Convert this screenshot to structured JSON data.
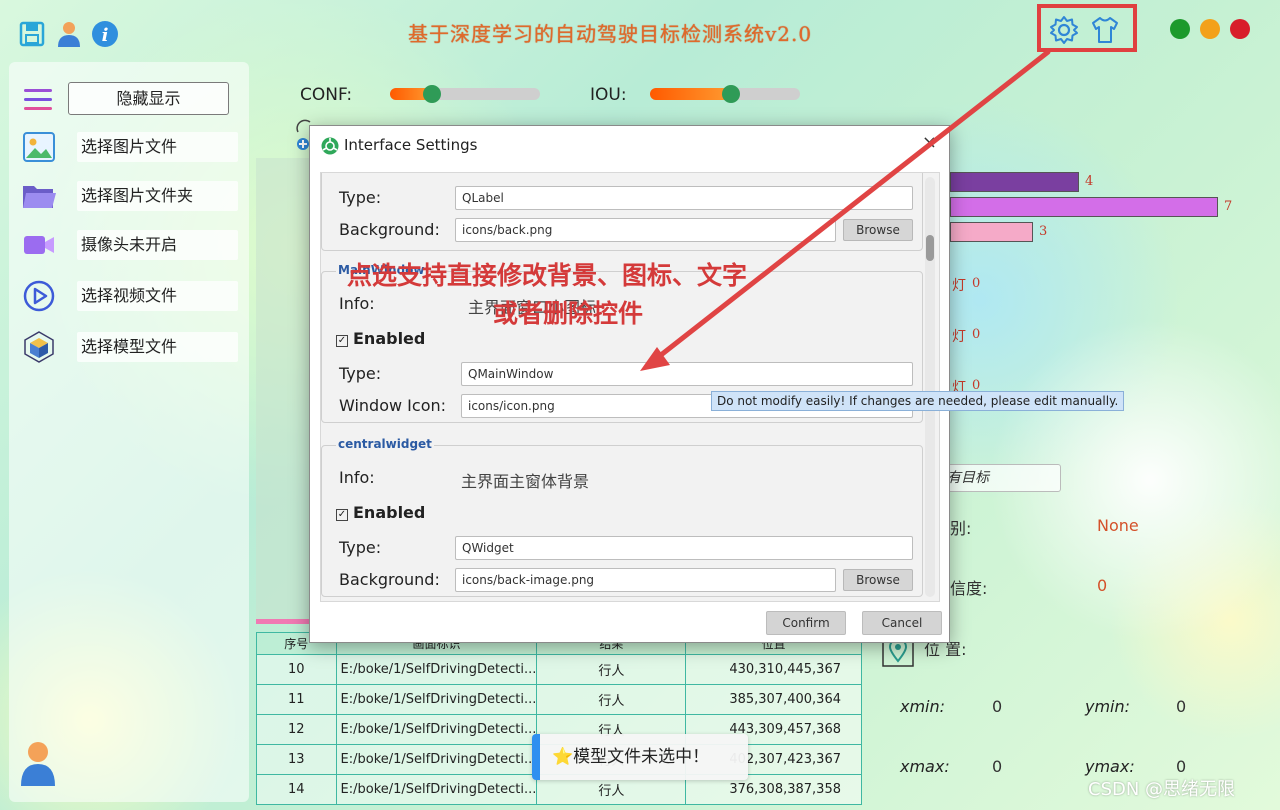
{
  "header": {
    "title": "基于深度学习的自动驾驶目标检测系统v2.0",
    "icons": [
      "save-icon",
      "user-icon",
      "info-icon",
      "settings-icon",
      "shirt-icon"
    ],
    "window_dots": [
      "#1c9a2c",
      "#f3a11a",
      "#d81e2a"
    ]
  },
  "sidebar": {
    "toggle_label": "隐藏显示",
    "items": [
      {
        "label": "选择图片文件",
        "icon": "image-icon"
      },
      {
        "label": "选择图片文件夹",
        "icon": "folder-icon"
      },
      {
        "label": "摄像头未开启",
        "icon": "camera-icon"
      },
      {
        "label": "选择视频文件",
        "icon": "play-icon"
      },
      {
        "label": "选择模型文件",
        "icon": "model-cube-icon"
      }
    ]
  },
  "sliders": {
    "conf": {
      "label": "CONF:",
      "value": 0.28
    },
    "iou": {
      "label": "IOU:",
      "value": 0.54
    }
  },
  "table": {
    "headers": [
      "序号",
      "画面标识",
      "结果",
      "位置"
    ],
    "rows": [
      {
        "id": "10",
        "path": "E:/boke/1/SelfDrivingDetecti...",
        "result": "行人",
        "pos": "430,310,445,367"
      },
      {
        "id": "11",
        "path": "E:/boke/1/SelfDrivingDetecti...",
        "result": "行人",
        "pos": "385,307,400,364"
      },
      {
        "id": "12",
        "path": "E:/boke/1/SelfDrivingDetecti...",
        "result": "行人",
        "pos": "443,309,457,368"
      },
      {
        "id": "13",
        "path": "E:/boke/1/SelfDrivingDetecti...",
        "result": "行人",
        "pos": "402,307,423,367"
      },
      {
        "id": "14",
        "path": "E:/boke/1/SelfDrivingDetecti...",
        "result": "行人",
        "pos": "376,308,387,358"
      }
    ]
  },
  "stats": {
    "bars": [
      {
        "value": "4",
        "color": "#7a3fa0"
      },
      {
        "value": "7",
        "color": "#d36ee8"
      },
      {
        "value": "3",
        "color": "#f5aac8"
      }
    ],
    "lights": [
      {
        "label": "灯",
        "value": "0"
      },
      {
        "label": "灯",
        "value": "0"
      },
      {
        "label": "灯",
        "value": "0"
      }
    ]
  },
  "detail": {
    "target_select": "有目标",
    "class_label": "别:",
    "class_value": "None",
    "conf_label": "信度:",
    "conf_value": "0",
    "pos_label": "位 置:",
    "xmin_label": "xmin:",
    "xmin_value": "0",
    "ymin_label": "ymin:",
    "ymin_value": "0",
    "xmax_label": "xmax:",
    "xmax_value": "0",
    "ymax_label": "ymax:",
    "ymax_value": "0"
  },
  "toast": {
    "icon": "⭐",
    "text": "模型文件未选中！"
  },
  "dialog": {
    "title": "Interface Settings",
    "close": "×",
    "group1": {
      "type_label": "Type:",
      "type_value": "QLabel",
      "bg_label": "Background:",
      "bg_value": "icons/back.png",
      "browse": "Browse"
    },
    "group2": {
      "title": "MainWindow",
      "info_label": "Info:",
      "info_value": "主界面窗口小图标",
      "enabled": "Enabled",
      "type_label": "Type:",
      "type_value": "QMainWindow",
      "icon_label": "Window Icon:",
      "icon_value": "icons/icon.png"
    },
    "group3": {
      "title": "centralwidget",
      "info_label": "Info:",
      "info_value": "主界面主窗体背景",
      "enabled": "Enabled",
      "type_label": "Type:",
      "type_value": "QWidget",
      "bg_label": "Background:",
      "bg_value": "icons/back-image.png",
      "browse": "Browse"
    },
    "confirm": "Confirm",
    "cancel": "Cancel"
  },
  "tooltip": "Do not modify easily! If changes are needed, please edit manually.",
  "annotation": {
    "line1": "点选支持直接修改背景、图标、文字",
    "line2": "或者删除控件",
    "color": "#d43a3a"
  },
  "watermark": "CSDN @思绪无限"
}
